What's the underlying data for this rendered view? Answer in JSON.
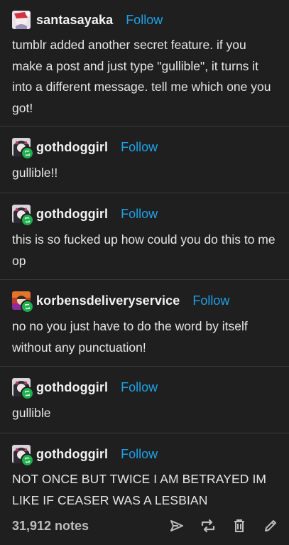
{
  "follow_label": "Follow",
  "posts": [
    {
      "username": "santasayaka",
      "text": "tumblr added another secret feature. if you make a post and just type \"gullible\", it turns it into a different message. tell me which one you got!"
    },
    {
      "username": "gothdoggirl",
      "text": "gullible!!"
    },
    {
      "username": "gothdoggirl",
      "text": "this is so fucked up how could you do this to me op"
    },
    {
      "username": "korbensdeliveryservice",
      "text": "no no you just have to do the word by itself without any punctuation!"
    },
    {
      "username": "gothdoggirl",
      "text": "gullible"
    },
    {
      "username": "gothdoggirl",
      "text": "NOT ONCE BUT TWICE I AM BETRAYED IM LIKE IF CEASER WAS A LESBIAN"
    }
  ],
  "footer": {
    "notes": "31,912 notes"
  },
  "icons": {
    "share": "share-icon",
    "reblog": "reblog-icon",
    "delete": "trash-icon",
    "edit": "pencil-icon"
  },
  "colors": {
    "background": "#1f1f1f",
    "accent": "#1ea1e8",
    "reblog": "#1fb04e",
    "text": "#e6e6e6"
  }
}
